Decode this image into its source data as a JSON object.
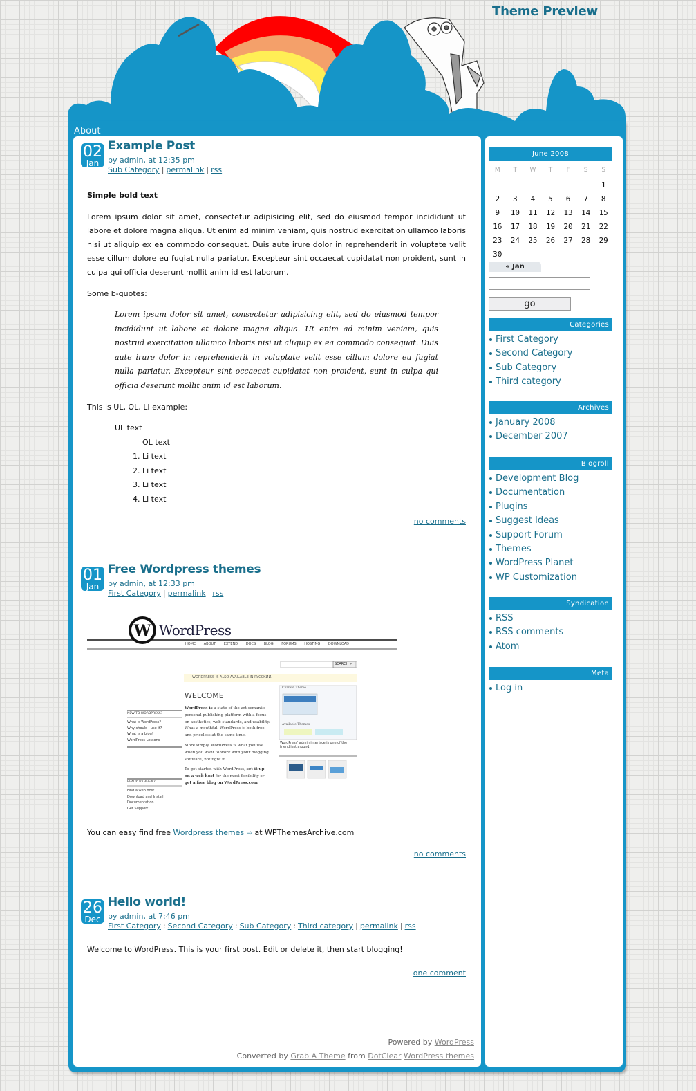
{
  "site": {
    "title": "Theme Preview",
    "nav": [
      {
        "label": "About"
      }
    ]
  },
  "colors": {
    "accent": "#1595c8",
    "link": "#1a6f8c",
    "rainbow": [
      "#ff0000",
      "#f4a06a",
      "#ffee55",
      "#ffffff"
    ]
  },
  "posts": [
    {
      "day": "02",
      "month": "Jan",
      "title": "Example Post",
      "byline": "by admin, at 12:35 pm",
      "categories": [
        "Sub Category"
      ],
      "permalink_label": "permalink",
      "rss_label": "rss",
      "body": {
        "bold_text": "Simple bold text",
        "paragraph": "Lorem ipsum dolor sit amet, consectetur adipisicing elit, sed do eiusmod tempor incididunt ut labore et dolore magna aliqua. Ut enim ad minim veniam, quis nostrud exercitation ullamco laboris nisi ut aliquip ex ea commodo consequat. Duis aute irure dolor in reprehenderit in voluptate velit esse cillum dolore eu fugiat nulla pariatur. Excepteur sint occaecat cupidatat non proident, sunt in culpa qui officia deserunt mollit anim id est laborum.",
        "bquotes_label": "Some b-quotes:",
        "blockquote": "Lorem ipsum dolor sit amet, consectetur adipisicing elit, sed do eiusmod tempor incididunt ut labore et dolore magna aliqua. Ut enim ad minim veniam, quis nostrud exercitation ullamco laboris nisi ut aliquip ex ea commodo consequat. Duis aute irure dolor in reprehenderit in voluptate velit esse cillum dolore eu fugiat nulla pariatur. Excepteur sint occaecat cupidatat non proident, sunt in culpa qui officia deserunt mollit anim id est laborum.",
        "list_label": "This is UL, OL, LI example:",
        "ul_text": "UL text",
        "ol_text": "OL text",
        "li_items": [
          "Li text",
          "Li text",
          "Li text",
          "Li text"
        ]
      },
      "comments_label": "no comments"
    },
    {
      "day": "01",
      "month": "Jan",
      "title": "Free Wordpress themes",
      "byline": "by admin, at 12:33 pm",
      "categories": [
        "First Category"
      ],
      "permalink_label": "permalink",
      "rss_label": "rss",
      "screenshot": {
        "logo_text": "WordPress",
        "nav": [
          "HOME",
          "ABOUT",
          "EXTEND",
          "DOCS",
          "BLOG",
          "FORUMS",
          "HOSTING",
          "DOWNLOAD"
        ],
        "search_button": "SEARCH »",
        "notice": "WORDPRESS IS ALSO AVAILABLE IN РУССКИЙ.",
        "welcome": "WELCOME",
        "new_heading": "NEW TO WORDPRESS?",
        "new_links": [
          "What is WordPress?",
          "Why should I use it?",
          "What is a blog?",
          "WordPress Lessons"
        ],
        "ready_heading": "READY TO BEGIN?",
        "ready_links": [
          "Find a web host",
          "Download and Install",
          "Documentation",
          "Get Support"
        ],
        "para1_bold": "WordPress is",
        "para1": " a state-of-the-art semantic personal publishing platform with a focus on aesthetics, web standards, and usability. What a mouthful. WordPress is both free and priceless at the same time.",
        "para2": "More simply, WordPress is what you use when you want to work with your blogging software, not fight it.",
        "para3_a": "To get started with WordPress, ",
        "para3_link1": "set it up on a web host",
        "para3_b": " for the most flexibility or ",
        "para3_link2": "get a free blog on WordPress.com",
        "caption": "WordPress' admin interface is one of the friendliest around.",
        "current_theme": "Current Theme",
        "available_themes": "Available Themes"
      },
      "body_text_before": "You can easy find free ",
      "body_link": "Wordpress themes",
      "body_text_after": " at WPThemesArchive.com",
      "comments_label": "no comments"
    },
    {
      "day": "26",
      "month": "Dec",
      "title": "Hello world!",
      "byline": "by admin, at 7:46 pm",
      "categories": [
        "First Category",
        "Second Category",
        "Sub Category",
        "Third category"
      ],
      "permalink_label": "permalink",
      "rss_label": "rss",
      "body_text": "Welcome to WordPress. This is your first post. Edit or delete it, then start blogging!",
      "comments_label": "one comment"
    }
  ],
  "footer": {
    "powered_prefix": "Powered by ",
    "powered_link": "WordPress",
    "converted_prefix": "Converted by ",
    "converted_link1": "Grab A Theme",
    "converted_mid": " from ",
    "converted_link2": "DotClear",
    "converted_link3": "WordPress themes"
  },
  "sidebar": {
    "calendar": {
      "caption": "June 2008",
      "weekdays": [
        "M",
        "T",
        "W",
        "T",
        "F",
        "S",
        "S"
      ],
      "weeks": [
        [
          "",
          "",
          "",
          "",
          "",
          "",
          "1"
        ],
        [
          "2",
          "3",
          "4",
          "5",
          "6",
          "7",
          "8"
        ],
        [
          "9",
          "10",
          "11",
          "12",
          "13",
          "14",
          "15"
        ],
        [
          "16",
          "17",
          "18",
          "19",
          "20",
          "21",
          "22"
        ],
        [
          "23",
          "24",
          "25",
          "26",
          "27",
          "28",
          "29"
        ],
        [
          "30",
          "",
          "",
          "",
          "",
          "",
          ""
        ]
      ],
      "prev_label": "« Jan"
    },
    "search": {
      "value": "",
      "placeholder": "",
      "button_label": "go"
    },
    "widgets": [
      {
        "title": "Categories",
        "items": [
          "First Category",
          "Second Category",
          "Sub Category",
          "Third category"
        ]
      },
      {
        "title": "Archives",
        "items": [
          "January 2008",
          "December 2007"
        ]
      },
      {
        "title": "Blogroll",
        "items": [
          "Development Blog",
          "Documentation",
          "Plugins",
          "Suggest Ideas",
          "Support Forum",
          "Themes",
          "WordPress Planet",
          "WP Customization"
        ]
      },
      {
        "title": "Syndication",
        "items": [
          "RSS",
          "RSS comments",
          "Atom"
        ]
      },
      {
        "title": "Meta",
        "items": [
          "Log in"
        ]
      }
    ]
  }
}
